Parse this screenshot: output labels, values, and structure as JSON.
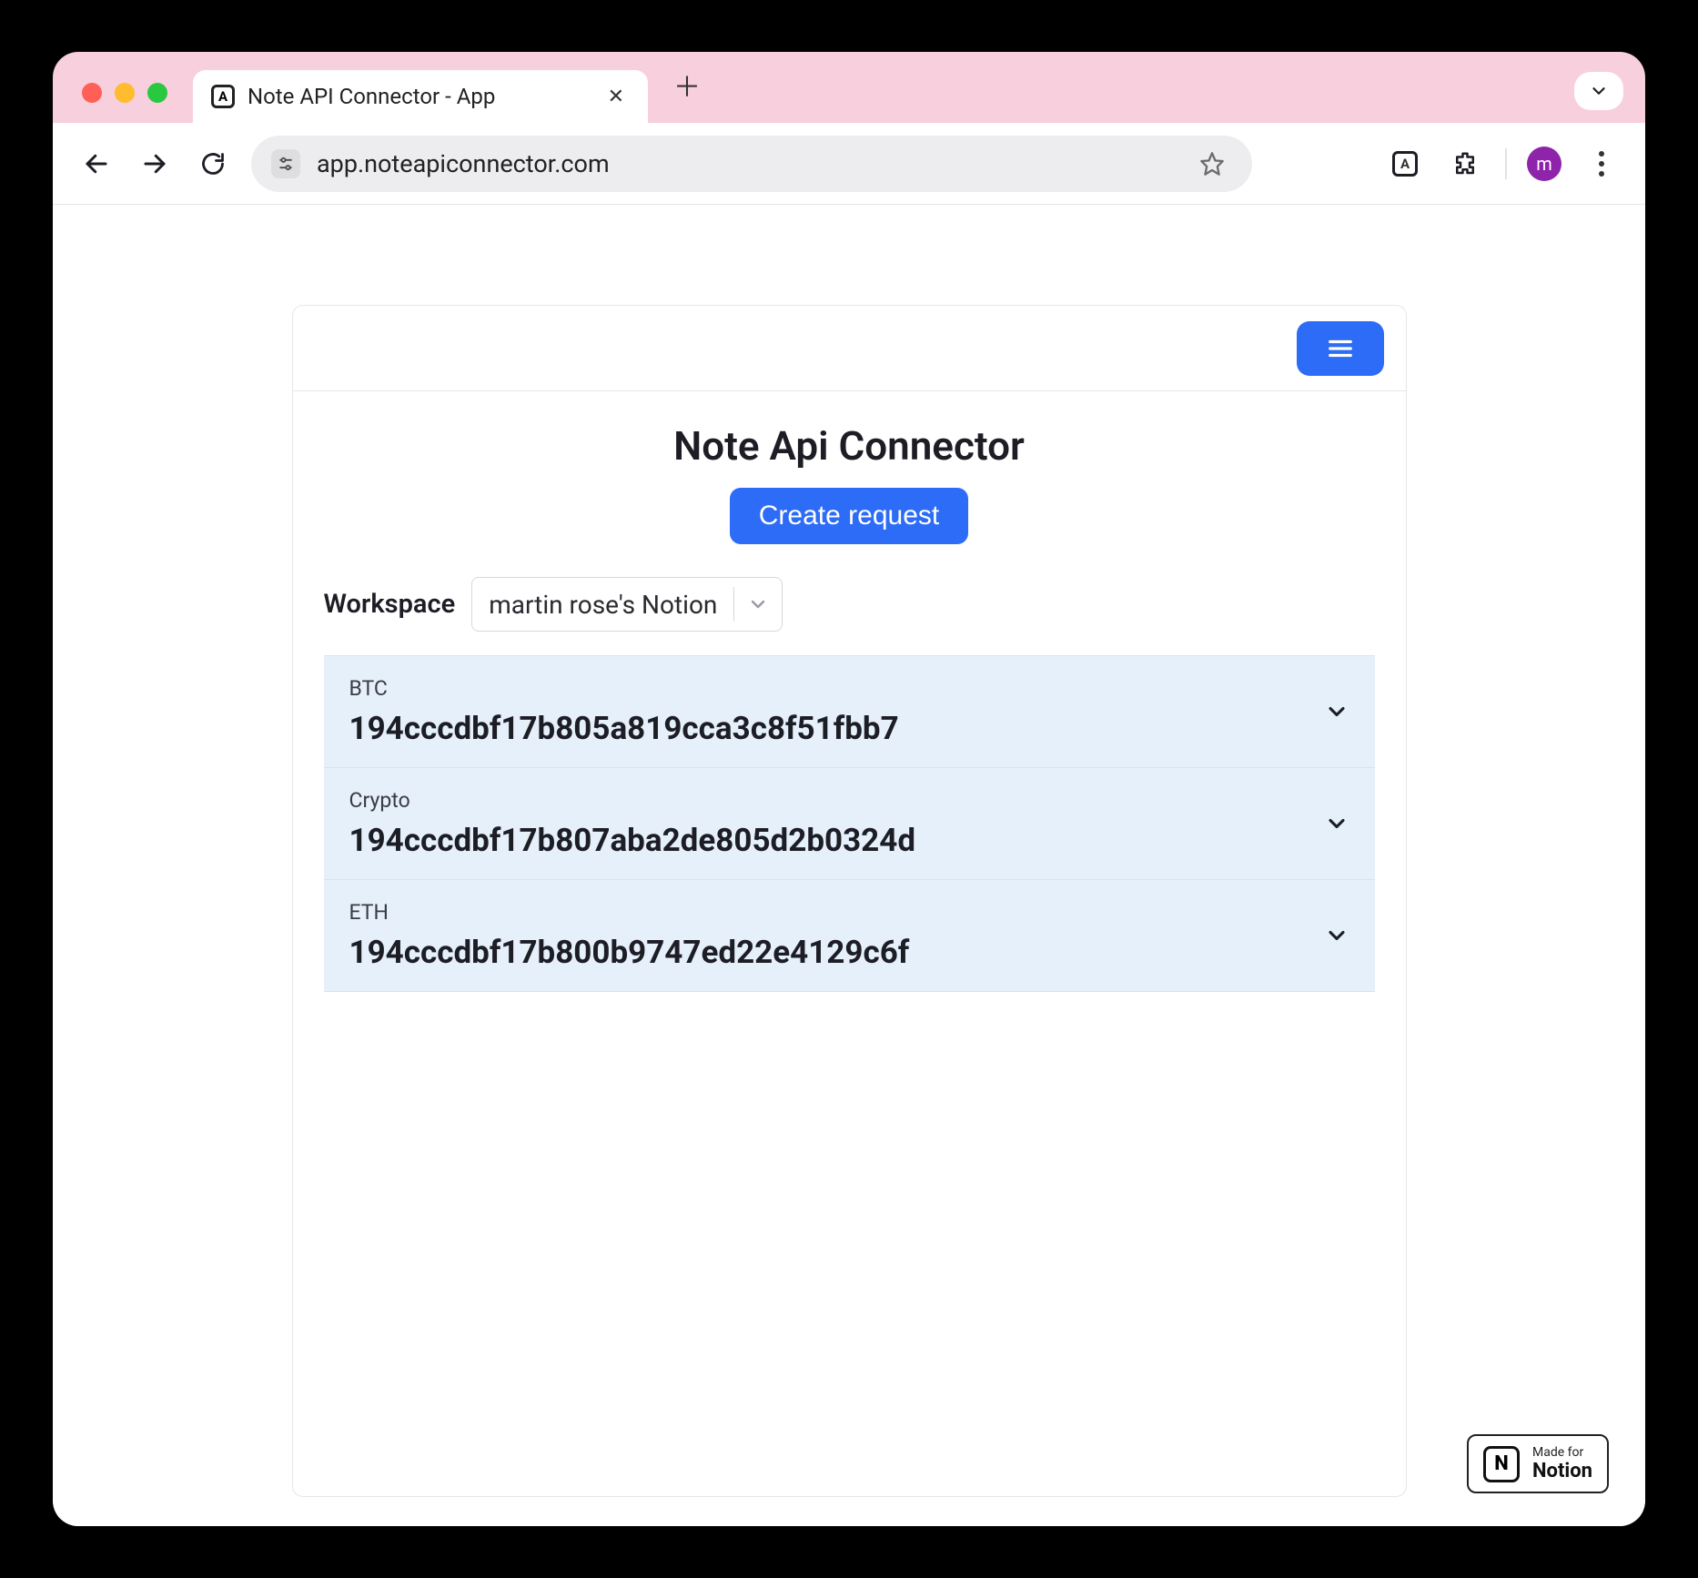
{
  "browser": {
    "tab_title": "Note API Connector - App",
    "url": "app.noteapiconnector.com",
    "avatar_initial": "m"
  },
  "app": {
    "title": "Note Api Connector",
    "create_button": "Create request",
    "workspace_label": "Workspace",
    "workspace_selected": "martin rose's Notion",
    "items": [
      {
        "label": "BTC",
        "id": "194cccdbf17b805a819cca3c8f51fbb7"
      },
      {
        "label": "Crypto",
        "id": "194cccdbf17b807aba2de805d2b0324d"
      },
      {
        "label": "ETH",
        "id": "194cccdbf17b800b9747ed22e4129c6f"
      }
    ]
  },
  "badge": {
    "line1": "Made for",
    "line2": "Notion"
  }
}
